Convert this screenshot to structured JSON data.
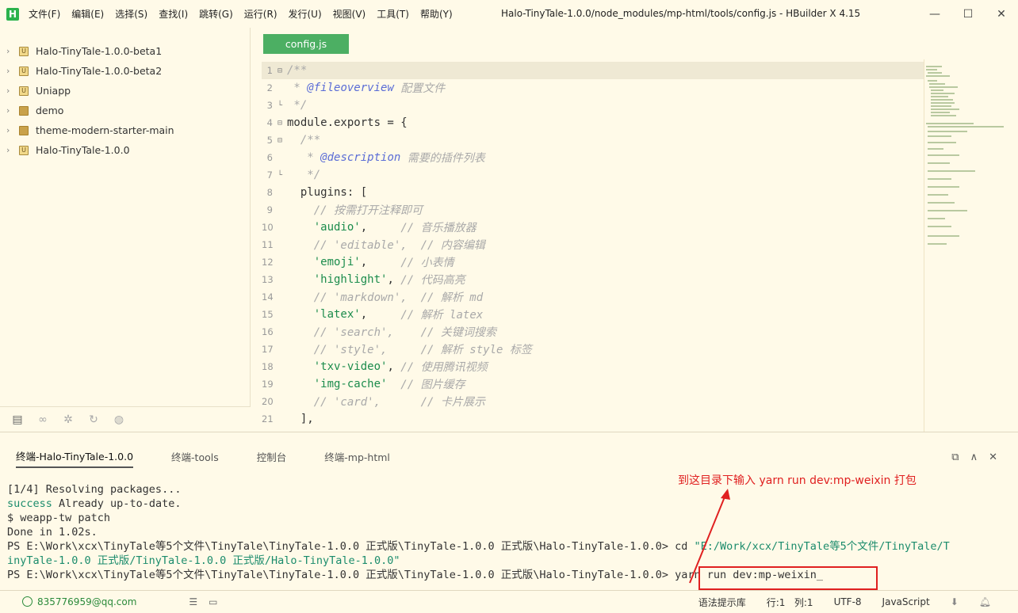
{
  "titlebar": {
    "logo": "H",
    "menu": [
      "文件(F)",
      "编辑(E)",
      "选择(S)",
      "查找(I)",
      "跳转(G)",
      "运行(R)",
      "发行(U)",
      "视图(V)",
      "工具(T)",
      "帮助(Y)"
    ],
    "title": "Halo-TinyTale-1.0.0/node_modules/mp-html/tools/config.js - HBuilder X 4.15",
    "minimize": "—",
    "maximize": "☐",
    "close": "✕"
  },
  "sidebar": {
    "items": [
      {
        "label": "Halo-TinyTale-1.0.0-beta1",
        "icon": "U"
      },
      {
        "label": "Halo-TinyTale-1.0.0-beta2",
        "icon": "U"
      },
      {
        "label": "Uniapp",
        "icon": "U"
      },
      {
        "label": "demo",
        "icon": "folder"
      },
      {
        "label": "theme-modern-starter-main",
        "icon": "folder"
      },
      {
        "label": "Halo-TinyTale-1.0.0",
        "icon": "U"
      }
    ],
    "tools": [
      "files-icon",
      "debug-glasses-icon",
      "bug-icon",
      "plugin-icon",
      "globe-icon"
    ]
  },
  "editor": {
    "tab": "config.js",
    "lines": [
      {
        "n": "1",
        "fold": "⊟",
        "parts": [
          {
            "c": "cmt",
            "t": "/**"
          }
        ]
      },
      {
        "n": "2",
        "fold": "",
        "parts": [
          {
            "c": "cmt",
            "t": " * "
          },
          {
            "c": "tag",
            "t": "@fileoverview"
          },
          {
            "c": "cmt",
            "t": " 配置文件"
          }
        ]
      },
      {
        "n": "3",
        "fold": "└",
        "parts": [
          {
            "c": "cmt",
            "t": " */"
          }
        ]
      },
      {
        "n": "4",
        "fold": "⊟",
        "parts": [
          {
            "c": "kw",
            "t": "module.exports = {"
          }
        ]
      },
      {
        "n": "5",
        "fold": "⊟",
        "parts": [
          {
            "c": "cmt",
            "t": "  /**"
          }
        ]
      },
      {
        "n": "6",
        "fold": "",
        "parts": [
          {
            "c": "cmt",
            "t": "   * "
          },
          {
            "c": "tag",
            "t": "@description"
          },
          {
            "c": "cmt",
            "t": " 需要的插件列表"
          }
        ]
      },
      {
        "n": "7",
        "fold": "└",
        "parts": [
          {
            "c": "cmt",
            "t": "   */"
          }
        ]
      },
      {
        "n": "8",
        "fold": "",
        "parts": [
          {
            "c": "kw",
            "t": "  plugins: ["
          }
        ]
      },
      {
        "n": "9",
        "fold": "",
        "parts": [
          {
            "c": "cmt",
            "t": "    // 按需打开注释即可"
          }
        ]
      },
      {
        "n": "10",
        "fold": "",
        "parts": [
          {
            "c": "kw",
            "t": "    "
          },
          {
            "c": "str",
            "t": "'audio'"
          },
          {
            "c": "kw",
            "t": ",     "
          },
          {
            "c": "cmt",
            "t": "// 音乐播放器"
          }
        ]
      },
      {
        "n": "11",
        "fold": "",
        "parts": [
          {
            "c": "cmt",
            "t": "    // 'editable',  // 内容编辑"
          }
        ]
      },
      {
        "n": "12",
        "fold": "",
        "parts": [
          {
            "c": "kw",
            "t": "    "
          },
          {
            "c": "str",
            "t": "'emoji'"
          },
          {
            "c": "kw",
            "t": ",     "
          },
          {
            "c": "cmt",
            "t": "// 小表情"
          }
        ]
      },
      {
        "n": "13",
        "fold": "",
        "parts": [
          {
            "c": "kw",
            "t": "    "
          },
          {
            "c": "str",
            "t": "'highlight'"
          },
          {
            "c": "kw",
            "t": ", "
          },
          {
            "c": "cmt",
            "t": "// 代码高亮"
          }
        ]
      },
      {
        "n": "14",
        "fold": "",
        "parts": [
          {
            "c": "cmt",
            "t": "    // 'markdown',  // 解析 md"
          }
        ]
      },
      {
        "n": "15",
        "fold": "",
        "parts": [
          {
            "c": "kw",
            "t": "    "
          },
          {
            "c": "str",
            "t": "'latex'"
          },
          {
            "c": "kw",
            "t": ",     "
          },
          {
            "c": "cmt",
            "t": "// 解析 latex"
          }
        ]
      },
      {
        "n": "16",
        "fold": "",
        "parts": [
          {
            "c": "cmt",
            "t": "    // 'search',    // 关键词搜索"
          }
        ]
      },
      {
        "n": "17",
        "fold": "",
        "parts": [
          {
            "c": "cmt",
            "t": "    // 'style',     // 解析 style 标签"
          }
        ]
      },
      {
        "n": "18",
        "fold": "",
        "parts": [
          {
            "c": "kw",
            "t": "    "
          },
          {
            "c": "str",
            "t": "'txv-video'"
          },
          {
            "c": "kw",
            "t": ", "
          },
          {
            "c": "cmt",
            "t": "// 使用腾讯视频"
          }
        ]
      },
      {
        "n": "19",
        "fold": "",
        "parts": [
          {
            "c": "kw",
            "t": "    "
          },
          {
            "c": "str",
            "t": "'img-cache'"
          },
          {
            "c": "kw",
            "t": "  "
          },
          {
            "c": "cmt",
            "t": "// 图片缓存"
          }
        ]
      },
      {
        "n": "20",
        "fold": "",
        "parts": [
          {
            "c": "cmt",
            "t": "    // 'card',      // 卡片展示"
          }
        ]
      },
      {
        "n": "21",
        "fold": "",
        "parts": [
          {
            "c": "kw",
            "t": "  ],"
          }
        ]
      }
    ]
  },
  "terminal": {
    "tabs": [
      "终端-Halo-TinyTale-1.0.0",
      "终端-tools",
      "控制台",
      "终端-mp-html"
    ],
    "actions": [
      "export-icon",
      "collapse-icon",
      "close-all-icon"
    ],
    "lines": [
      {
        "parts": [
          {
            "c": "",
            "t": "[1/4] Resolving packages..."
          }
        ]
      },
      {
        "parts": [
          {
            "c": "t-green",
            "t": "success"
          },
          {
            "c": "",
            "t": " Already up-to-date."
          }
        ]
      },
      {
        "parts": [
          {
            "c": "",
            "t": "$ weapp-tw patch"
          }
        ]
      },
      {
        "parts": [
          {
            "c": "",
            "t": "Done in 1.02s."
          }
        ]
      },
      {
        "parts": [
          {
            "c": "",
            "t": "PS E:\\Work\\xcx\\TinyTale等5个文件\\TinyTale\\TinyTale-1.0.0 正式版\\TinyTale-1.0.0 正式版\\Halo-TinyTale-1.0.0> cd "
          },
          {
            "c": "t-path",
            "t": "\"E:/Work/xcx/TinyTale等5个文件/TinyTale/T"
          }
        ]
      },
      {
        "parts": [
          {
            "c": "t-path",
            "t": "inyTale-1.0.0 正式版/TinyTale-1.0.0 正式版/Halo-TinyTale-1.0.0\""
          }
        ]
      },
      {
        "parts": [
          {
            "c": "",
            "t": "PS E:\\Work\\xcx\\TinyTale等5个文件\\TinyTale\\TinyTale-1.0.0 正式版\\TinyTale-1.0.0 正式版\\Halo-TinyTale-1.0.0> yarn run dev:mp-weixin_"
          }
        ]
      }
    ],
    "annotation": "到这目录下输入  yarn run dev:mp-weixin 打包"
  },
  "statusbar": {
    "user": "835776959@qq.com",
    "syntax_hint": "语法提示库",
    "position": "行:1   列:1",
    "encoding": "UTF-8",
    "language": "JavaScript"
  },
  "colors": {
    "accent": "#4caf63",
    "annotation": "#e02020",
    "background": "#fffae8"
  }
}
